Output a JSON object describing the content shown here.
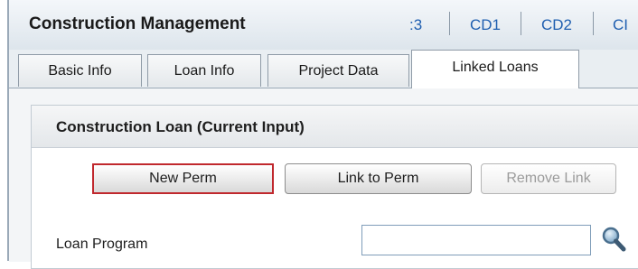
{
  "header": {
    "title": "Construction Management",
    "tabs": [
      ":3",
      "CD1",
      "CD2",
      "CI"
    ]
  },
  "subtabs": [
    "Basic Info",
    "Loan Info",
    "Project Data",
    "Linked Loans"
  ],
  "active_subtab": "Linked Loans",
  "panel": {
    "title": "Construction Loan (Current Input)",
    "buttons": {
      "new_perm": "New Perm",
      "link_to_perm": "Link to Perm",
      "remove_link": "Remove Link"
    },
    "loan_program": {
      "label": "Loan Program",
      "value": "",
      "lookup_icon": "magnifier-icon"
    }
  },
  "colors": {
    "link_blue": "#1f5fb0",
    "highlight_red": "#c0282d"
  }
}
